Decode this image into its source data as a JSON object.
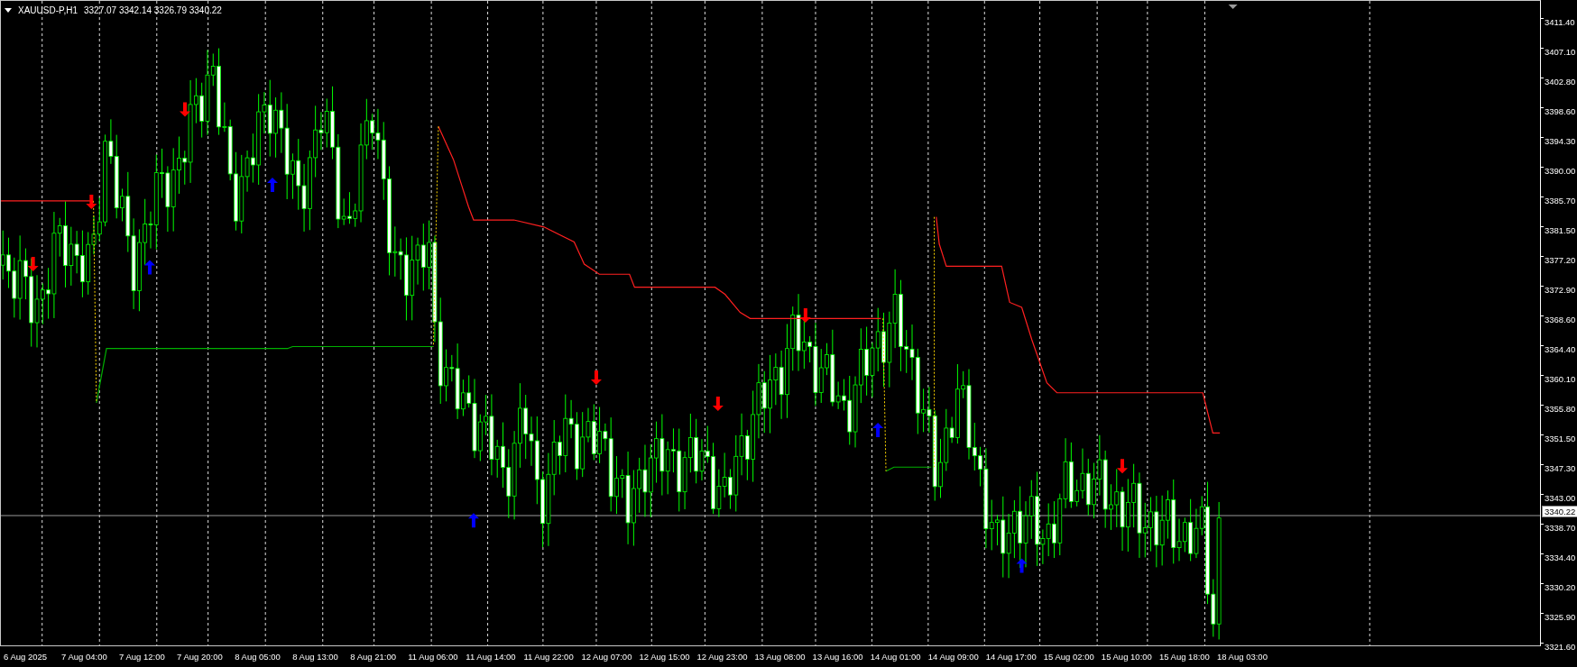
{
  "chart": {
    "symbol": "XAUUSD-P,H1",
    "ohlc": "3327.07 3342.14 3326.79 3340.22"
  },
  "price_axis": {
    "labels": [
      "3411.40",
      "3407.10",
      "3402.80",
      "3398.60",
      "3394.30",
      "3390.00",
      "3385.70",
      "3381.50",
      "3377.20",
      "3372.90",
      "3368.60",
      "3364.40",
      "3360.10",
      "3355.80",
      "3351.50",
      "3347.30",
      "3343.00",
      "3338.70",
      "3334.40",
      "3330.20",
      "3325.90",
      "3321.60"
    ],
    "current_price": "3340.22"
  },
  "time_axis": {
    "labels": [
      "6 Aug 2025",
      "7 Aug 04:00",
      "7 Aug 12:00",
      "7 Aug 20:00",
      "8 Aug 05:00",
      "8 Aug 13:00",
      "8 Aug 21:00",
      "11 Aug 06:00",
      "11 Aug 14:00",
      "11 Aug 22:00",
      "12 Aug 07:00",
      "12 Aug 15:00",
      "12 Aug 23:00",
      "13 Aug 08:00",
      "13 Aug 16:00",
      "14 Aug 01:00",
      "14 Aug 09:00",
      "14 Aug 17:00",
      "15 Aug 02:00",
      "15 Aug 10:00",
      "15 Aug 18:00",
      "18 Aug 03:00"
    ]
  }
}
